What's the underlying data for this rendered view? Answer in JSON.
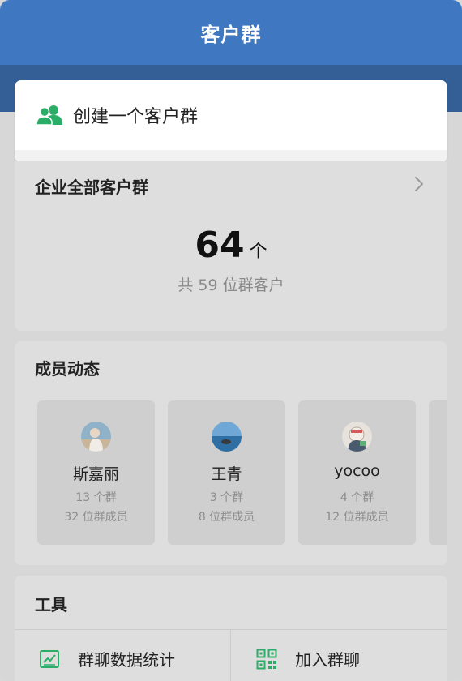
{
  "header": {
    "title": "客户群"
  },
  "create": {
    "label": "创建一个客户群",
    "icon": "people-icon",
    "accent": "#2aae67"
  },
  "all_groups": {
    "title": "企业全部客户群",
    "count": "64",
    "unit": "个",
    "subtitle": "共 59 位群客户"
  },
  "members": {
    "title": "成员动态",
    "items": [
      {
        "name": "斯嘉丽",
        "groups": "13 个群",
        "members": "32 位群成员"
      },
      {
        "name": "王青",
        "groups": "3 个群",
        "members": "8 位群成员"
      },
      {
        "name": "yocoo",
        "groups": "4 个群",
        "members": "12 位群成员"
      }
    ]
  },
  "tools": {
    "title": "工具",
    "items": [
      {
        "label": "群聊数据统计",
        "icon": "chart-icon"
      },
      {
        "label": "加入群聊",
        "icon": "qr-code-icon"
      }
    ]
  },
  "colors": {
    "header_bg": "#3f78c0",
    "accent_green": "#2aae67"
  }
}
